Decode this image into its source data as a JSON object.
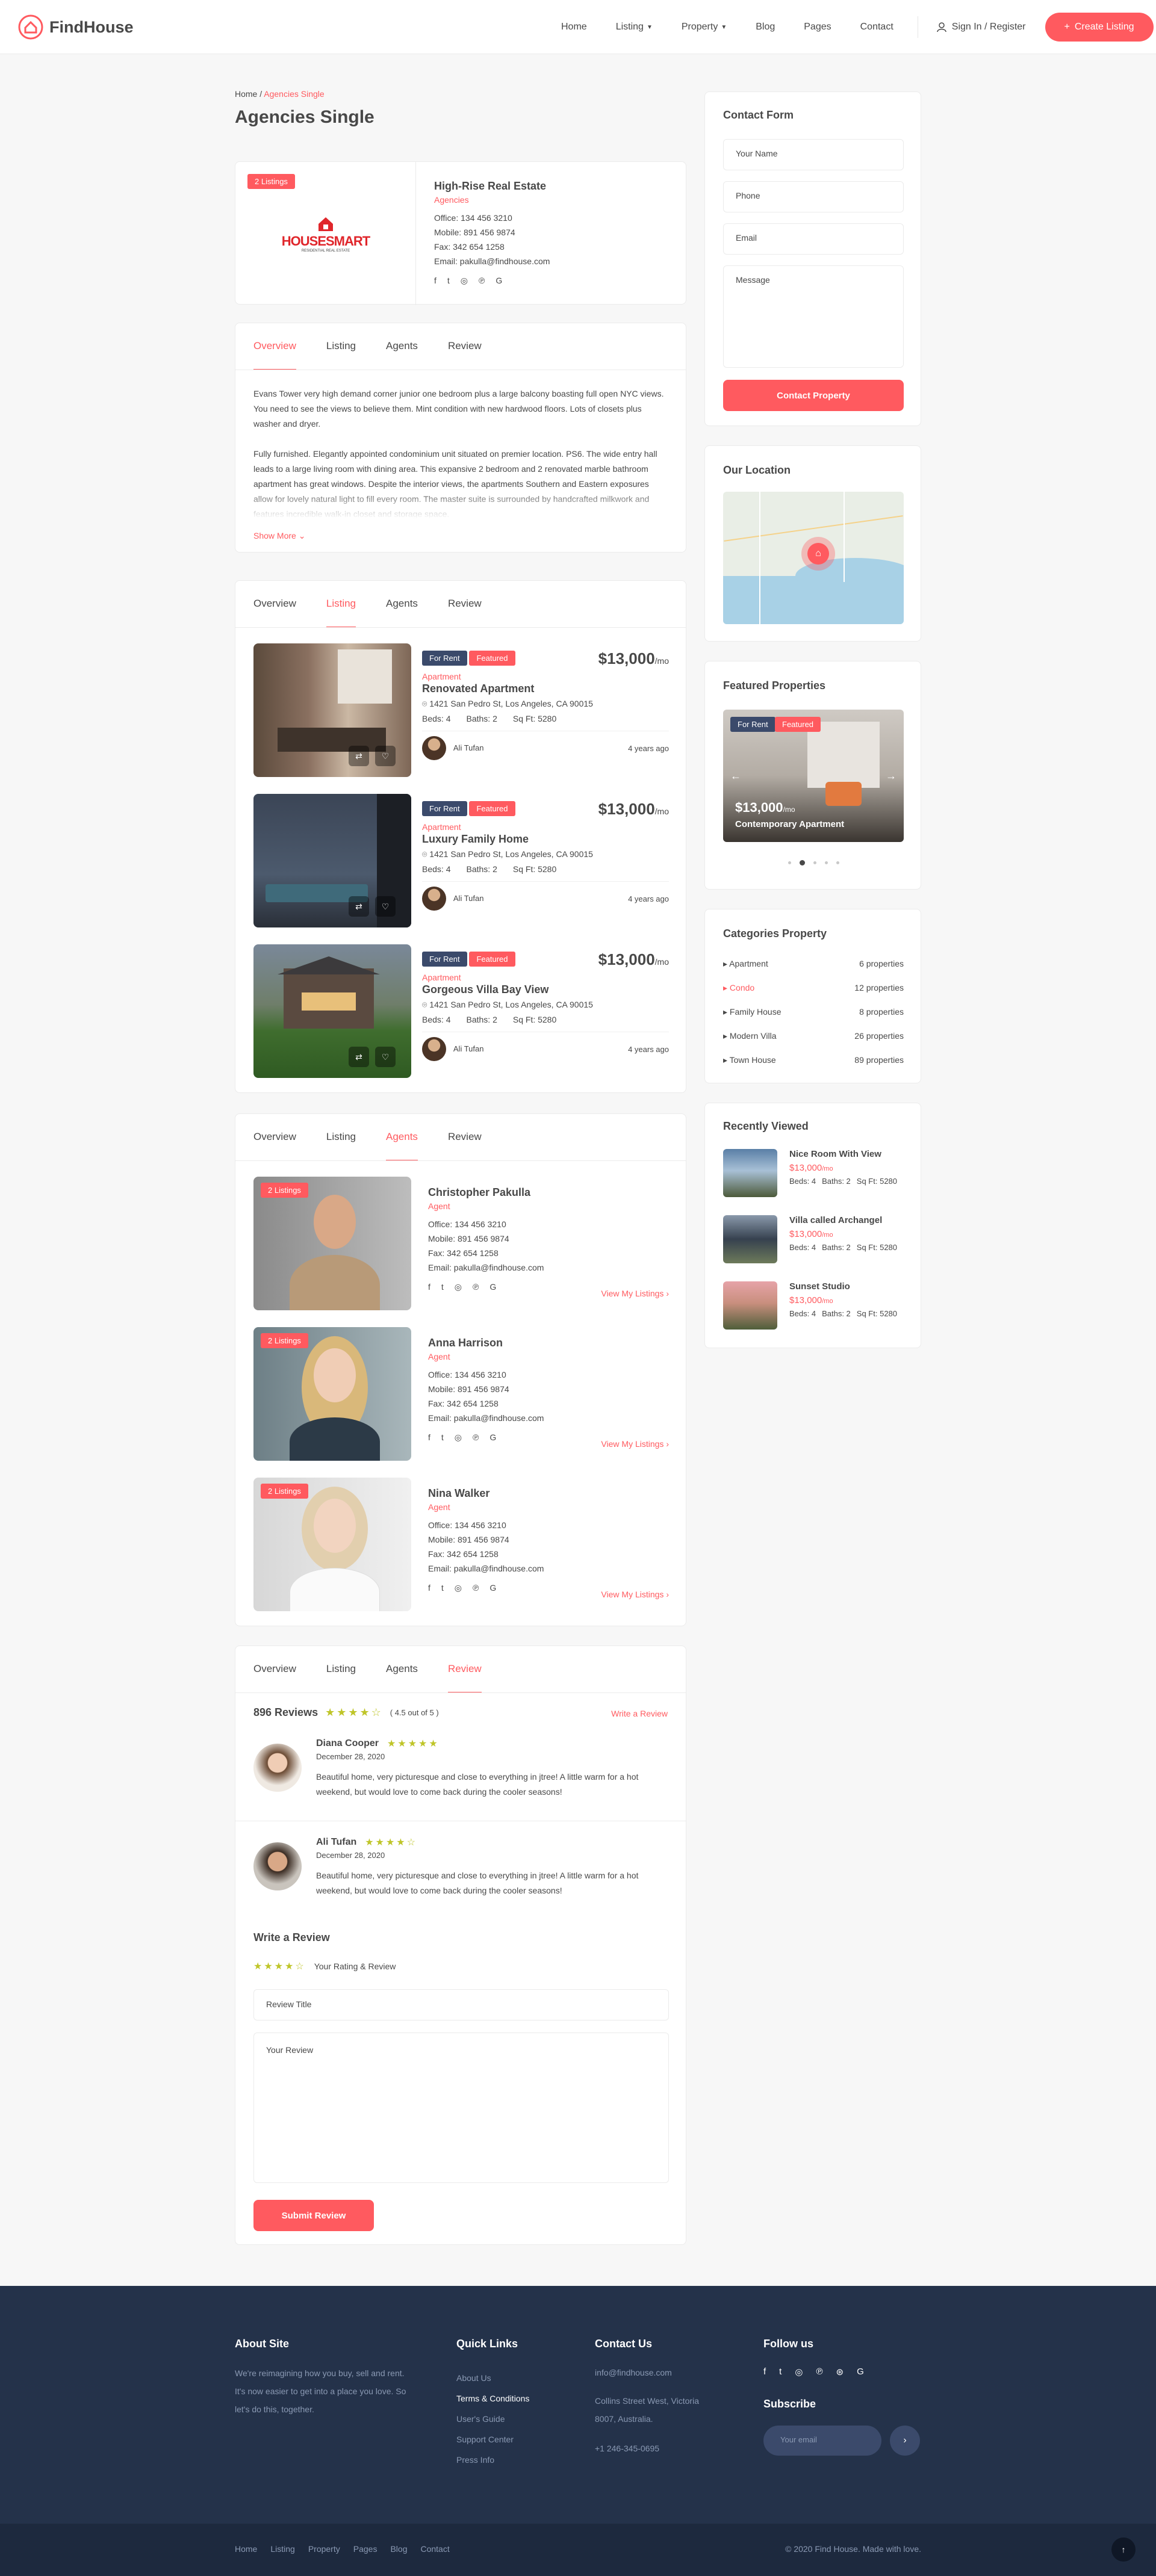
{
  "header": {
    "brand": "FindHouse",
    "nav": [
      "Home",
      "Listing",
      "Property",
      "Blog",
      "Pages",
      "Contact"
    ],
    "signin": "Sign In / Register",
    "create": "Create Listing"
  },
  "breadcrumb": {
    "home": "Home",
    "current": "Agencies Single"
  },
  "page_title": "Agencies Single",
  "agency": {
    "badge": "2 Listings",
    "logo_main": "HOUSESMART",
    "logo_sub": "RESIDENTIAL REAL ESTATE",
    "name": "High-Rise Real Estate",
    "type": "Agencies",
    "office": "Office: 134 456 3210",
    "mobile": "Mobile: 891 456 9874",
    "fax": "Fax: 342 654 1258",
    "email": "Email: pakulla@findhouse.com"
  },
  "tabs": [
    "Overview",
    "Listing",
    "Agents",
    "Review"
  ],
  "overview": {
    "p1": "Evans Tower very high demand corner junior one bedroom plus a large balcony boasting full open NYC views. You need to see the views to believe them. Mint condition with new hardwood floors. Lots of closets plus washer and dryer.",
    "p2": "Fully furnished. Elegantly appointed condominium unit situated on premier location. PS6. The wide entry hall leads to a large living room with dining area. This expansive 2 bedroom and 2 renovated marble bathroom apartment has great windows. Despite the interior views, the apartments Southern and Eastern exposures allow for lovely natural light to fill every room. The master suite is surrounded by handcrafted milkwork and features incredible walk-in closet and storage space.",
    "more": "Show More"
  },
  "listings": [
    {
      "tag1": "For Rent",
      "tag2": "Featured",
      "price": "$13,000",
      "per": "/mo",
      "cat": "Apartment",
      "title": "Renovated Apartment",
      "addr": "1421 San Pedro St, Los Angeles, CA 90015",
      "beds": "Beds: 4",
      "baths": "Baths: 2",
      "sqft": "Sq Ft: 5280",
      "agent": "Ali Tufan",
      "time": "4 years ago"
    },
    {
      "tag1": "For Rent",
      "tag2": "Featured",
      "price": "$13,000",
      "per": "/mo",
      "cat": "Apartment",
      "title": "Luxury Family Home",
      "addr": "1421 San Pedro St, Los Angeles, CA 90015",
      "beds": "Beds: 4",
      "baths": "Baths: 2",
      "sqft": "Sq Ft: 5280",
      "agent": "Ali Tufan",
      "time": "4 years ago"
    },
    {
      "tag1": "For Rent",
      "tag2": "Featured",
      "price": "$13,000",
      "per": "/mo",
      "cat": "Apartment",
      "title": "Gorgeous Villa Bay View",
      "addr": "1421 San Pedro St, Los Angeles, CA 90015",
      "beds": "Beds: 4",
      "baths": "Baths: 2",
      "sqft": "Sq Ft: 5280",
      "agent": "Ali Tufan",
      "time": "4 years ago"
    }
  ],
  "agents": [
    {
      "badge": "2 Listings",
      "name": "Christopher Pakulla",
      "role": "Agent",
      "office": "Office: 134 456 3210",
      "mobile": "Mobile: 891 456 9874",
      "fax": "Fax: 342 654 1258",
      "email": "Email: pakulla@findhouse.com",
      "link": "View My Listings"
    },
    {
      "badge": "2 Listings",
      "name": "Anna Harrison",
      "role": "Agent",
      "office": "Office: 134 456 3210",
      "mobile": "Mobile: 891 456 9874",
      "fax": "Fax: 342 654 1258",
      "email": "Email: pakulla@findhouse.com",
      "link": "View My Listings"
    },
    {
      "badge": "2 Listings",
      "name": "Nina Walker",
      "role": "Agent",
      "office": "Office: 134 456 3210",
      "mobile": "Mobile: 891 456 9874",
      "fax": "Fax: 342 654 1258",
      "email": "Email: pakulla@findhouse.com",
      "link": "View My Listings"
    }
  ],
  "reviews": {
    "count": "896 Reviews",
    "stars": "★★★★☆",
    "avg": "( 4.5 out of 5 )",
    "write_link": "Write a Review",
    "items": [
      {
        "name": "Diana Cooper",
        "stars": "★★★★★",
        "date": "December 28, 2020",
        "text": "Beautiful home, very picturesque and close to everything in jtree! A little warm for a hot weekend, but would love to come back during the cooler seasons!"
      },
      {
        "name": "Ali Tufan",
        "stars": "★★★★☆",
        "date": "December 28, 2020",
        "text": "Beautiful home, very picturesque and close to everything in jtree! A little warm for a hot weekend, but would love to come back during the cooler seasons!"
      }
    ],
    "form_title": "Write a Review",
    "rating_stars": "★★★★☆",
    "rating_label": "Your Rating & Review",
    "title_ph": "Review Title",
    "review_ph": "Your Review",
    "submit": "Submit Review"
  },
  "contact_form": {
    "title": "Contact Form",
    "name": "Your Name",
    "phone": "Phone",
    "email": "Email",
    "message": "Message",
    "submit": "Contact Property"
  },
  "location": {
    "title": "Our Location"
  },
  "featured": {
    "title": "Featured Properties",
    "tag1": "For Rent",
    "tag2": "Featured",
    "price": "$13,000",
    "per": "/mo",
    "name": "Contemporary Apartment"
  },
  "categories": {
    "title": "Categories Property",
    "items": [
      {
        "name": "Apartment",
        "count": "6 properties"
      },
      {
        "name": "Condo",
        "count": "12 properties"
      },
      {
        "name": "Family House",
        "count": "8 properties"
      },
      {
        "name": "Modern Villa",
        "count": "26 properties"
      },
      {
        "name": "Town House",
        "count": "89 properties"
      }
    ]
  },
  "recent": {
    "title": "Recently Viewed",
    "items": [
      {
        "name": "Nice Room With View",
        "price": "$13,000",
        "per": "/mo",
        "beds": "Beds: 4",
        "baths": "Baths: 2",
        "sqft": "Sq Ft: 5280"
      },
      {
        "name": "Villa called Archangel",
        "price": "$13,000",
        "per": "/mo",
        "beds": "Beds: 4",
        "baths": "Baths: 2",
        "sqft": "Sq Ft: 5280"
      },
      {
        "name": "Sunset Studio",
        "price": "$13,000",
        "per": "/mo",
        "beds": "Beds: 4",
        "baths": "Baths: 2",
        "sqft": "Sq Ft: 5280"
      }
    ]
  },
  "footer": {
    "about_h": "About Site",
    "about": "We're reimagining how you buy, sell and rent. It's now easier to get into a place you love. So let's do this, together.",
    "quick_h": "Quick Links",
    "quick": [
      "About Us",
      "Terms & Conditions",
      "User's Guide",
      "Support Center",
      "Press Info"
    ],
    "contact_h": "Contact Us",
    "c_email": "info@findhouse.com",
    "c_addr": "Collins Street West, Victoria 8007, Australia.",
    "c_phone": "+1 246-345-0695",
    "follow_h": "Follow us",
    "subscribe_h": "Subscribe",
    "sub_ph": "Your email",
    "bottom_nav": [
      "Home",
      "Listing",
      "Property",
      "Pages",
      "Blog",
      "Contact"
    ],
    "copyright": "© 2020 Find House. Made with love."
  }
}
